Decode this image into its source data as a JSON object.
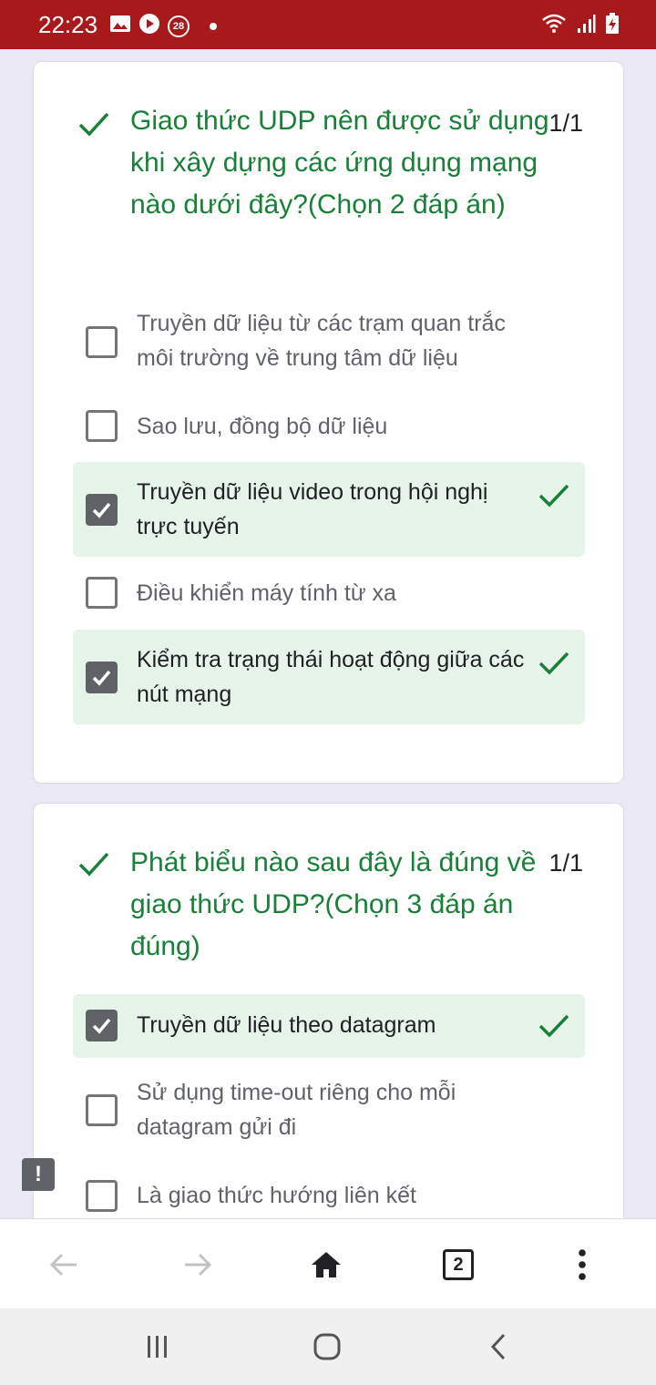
{
  "status_bar": {
    "time": "22:23",
    "notification_badge": "28",
    "left_icons": [
      "image-icon",
      "play-icon",
      "badge-28-icon",
      "dot-icon"
    ],
    "right_icons": [
      "wifi-icon",
      "signal-icon",
      "battery-charging-icon"
    ],
    "background_color": "#a8191c"
  },
  "questions": [
    {
      "text": "Giao thức UDP nên được sử dụng khi xây dựng các ứng dụng mạng nào dưới đây?(Chọn 2 đáp án)",
      "score": "1/1",
      "result": "correct",
      "options": [
        {
          "label": "Truyền dữ liệu từ các trạm quan trắc môi trường về trung tâm dữ liệu",
          "checked": false,
          "correct": false
        },
        {
          "label": "Sao lưu, đồng bộ dữ liệu",
          "checked": false,
          "correct": false
        },
        {
          "label": "Truyền dữ liệu video trong hội nghị trực tuyến",
          "checked": true,
          "correct": true
        },
        {
          "label": "Điều khiển máy tính từ xa",
          "checked": false,
          "correct": false
        },
        {
          "label": "Kiểm tra trạng thái hoạt động giữa các nút mạng",
          "checked": true,
          "correct": true
        }
      ]
    },
    {
      "text": "Phát biểu nào sau đây là đúng về giao thức UDP?(Chọn 3 đáp án đúng)",
      "score": "1/1",
      "result": "correct",
      "options": [
        {
          "label": "Truyền dữ liệu theo datagram",
          "checked": true,
          "correct": true
        },
        {
          "label": "Sử dụng time-out riêng cho mỗi datagram gửi đi",
          "checked": false,
          "correct": false
        },
        {
          "label": "Là giao thức hướng liên kết",
          "checked": false,
          "correct": false
        }
      ]
    }
  ],
  "feedback_button": {
    "icon": "report-feedback-icon",
    "glyph": "!"
  },
  "browser_toolbar": {
    "tab_count": "2",
    "buttons": [
      "back-arrow-icon",
      "forward-arrow-icon",
      "home-icon",
      "tabs-icon",
      "more-vert-icon"
    ]
  },
  "system_nav": {
    "buttons": [
      "recents-icon",
      "home-icon",
      "back-icon"
    ]
  },
  "colors": {
    "accent_green": "#188038",
    "correct_bg": "#e6f4ea",
    "page_bg": "#ebe8f5"
  }
}
